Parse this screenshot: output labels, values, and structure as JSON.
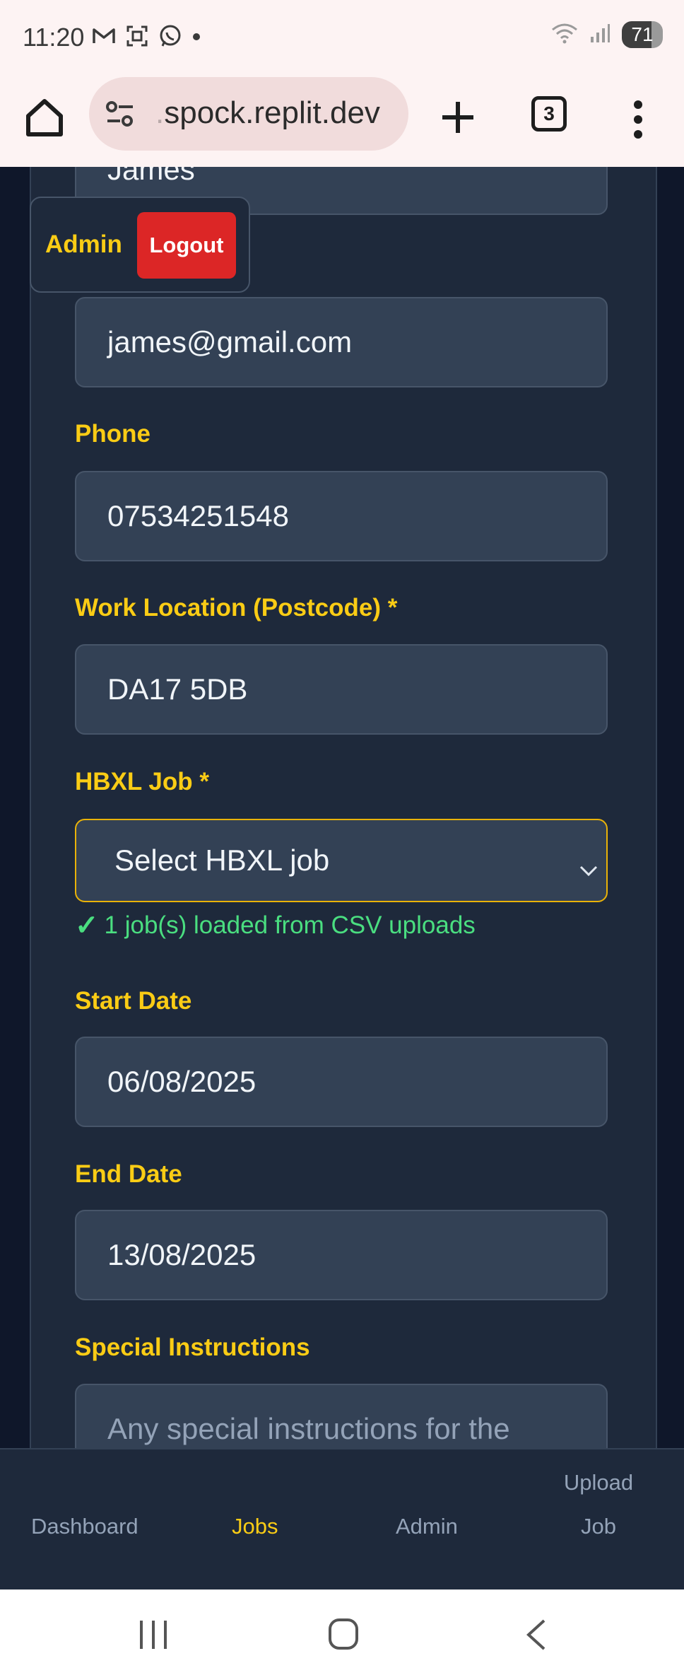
{
  "status": {
    "time": "11:20",
    "battery": "71",
    "icons_left": [
      "gmail-icon",
      "screenshot-icon",
      "whatsapp-icon",
      "dot-icon"
    ],
    "icons_right": [
      "wifi-icon",
      "signal-icon",
      "battery-icon"
    ]
  },
  "browser": {
    "url_faded": ".",
    "url": "spock.replit.dev",
    "tab_count": "3"
  },
  "form": {
    "name_value": "James",
    "email_value": "james@gmail.com",
    "phone_label": "Phone",
    "phone_value": "07534251548",
    "location_label": "Work Location (Postcode) *",
    "location_value": "DA17 5DB",
    "hbxl_label": "HBXL Job *",
    "hbxl_selected": "Select HBXL job",
    "csv_check": "✓",
    "csv_note": "1 job(s) loaded from CSV uploads",
    "start_label": "Start Date",
    "start_value": "06/08/2025",
    "end_label": "End Date",
    "end_value": "13/08/2025",
    "instructions_label": "Special Instructions",
    "instructions_placeholder": "Any special instructions for the"
  },
  "admin_popup": {
    "label": "Admin",
    "logout": "Logout"
  },
  "bottom_nav": {
    "dashboard": "Dashboard",
    "jobs": "Jobs",
    "admin": "Admin",
    "upload_line1": "Upload",
    "upload_line2": "Job",
    "active": "Jobs"
  },
  "colors": {
    "accent": "#facc15",
    "danger": "#dc2626",
    "success": "#4ade80",
    "background": "#0f172a",
    "card": "#1e293b"
  }
}
